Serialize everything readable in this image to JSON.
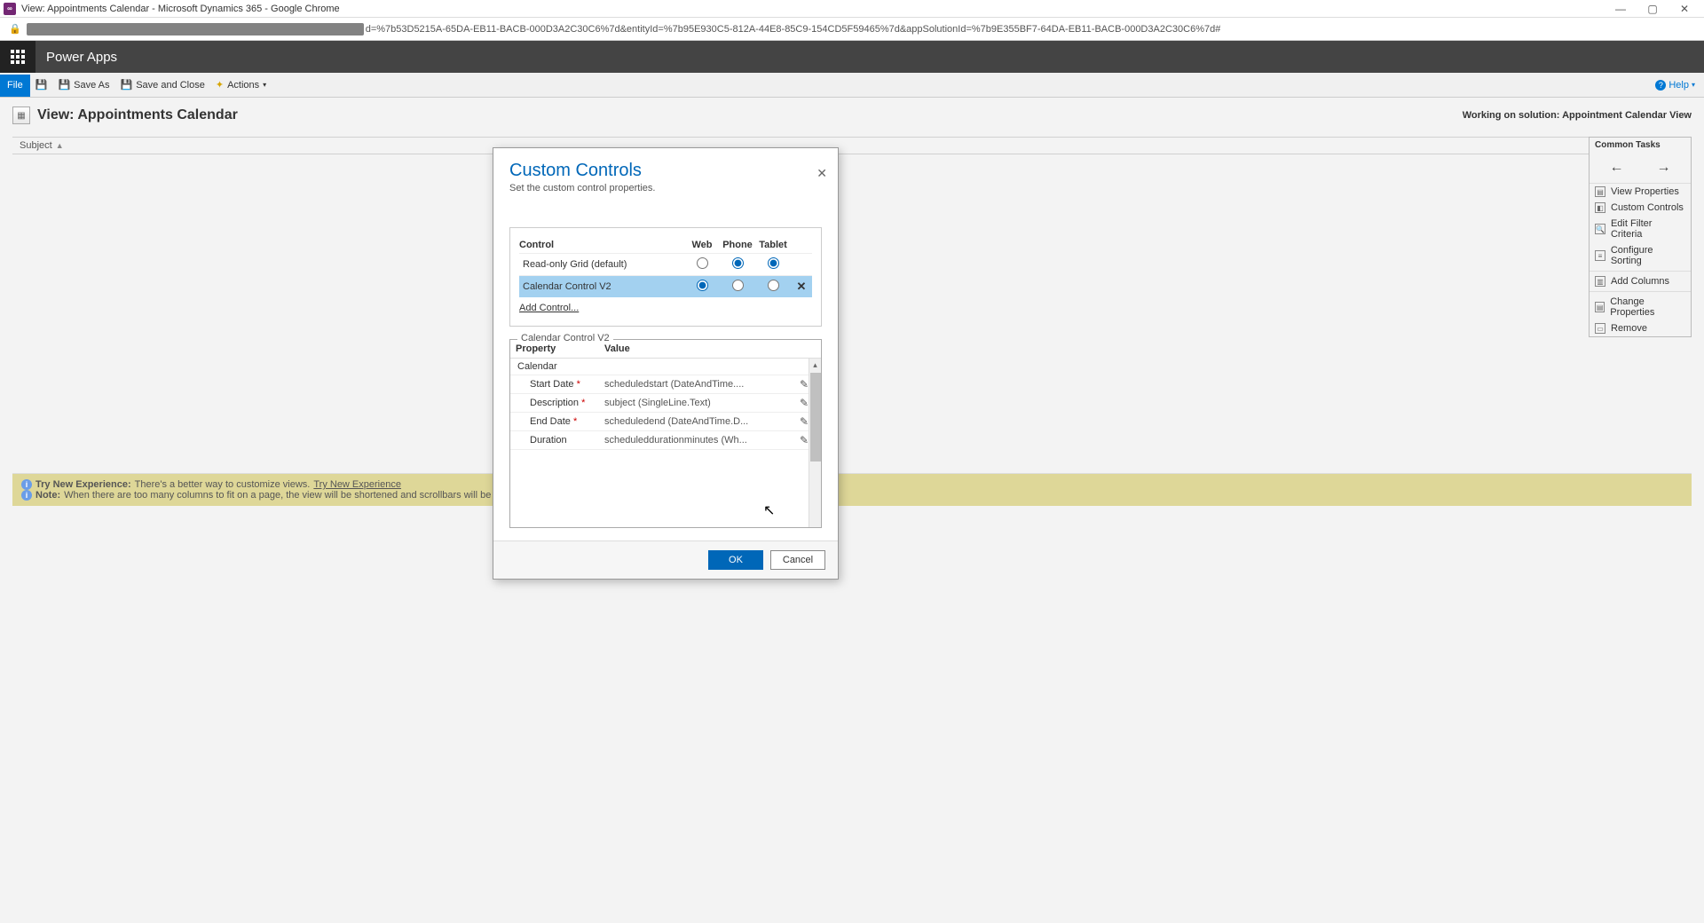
{
  "chrome": {
    "title": "View: Appointments Calendar - Microsoft Dynamics 365 - Google Chrome",
    "url_tail": "d=%7b53D5215A-65DA-EB11-BACB-000D3A2C30C6%7d&entityId=%7b95E930C5-812A-44E8-85C9-154CD5F59465%7d&appSolutionId=%7b9E355BF7-64DA-EB11-BACB-000D3A2C30C6%7d#"
  },
  "pa": {
    "brand": "Power Apps"
  },
  "toolbar": {
    "file": "File",
    "save_as": "Save As",
    "save_close": "Save and Close",
    "actions": "Actions",
    "help": "Help"
  },
  "page": {
    "title": "View: Appointments Calendar",
    "working": "Working on solution: Appointment Calendar View",
    "subject": "Subject"
  },
  "notice": {
    "line1_b": "Try New Experience:",
    "line1": " There's a better way to customize views. ",
    "link": "Try New Experience",
    "line2_b": "Note:",
    "line2": " When there are too many columns to fit on a page, the view will be shortened and scrollbars will be added."
  },
  "tasks": {
    "title": "Common Tasks",
    "view_props": "View Properties",
    "custom_controls": "Custom Controls",
    "edit_filter": "Edit Filter Criteria",
    "configure_sort": "Configure Sorting",
    "add_columns": "Add Columns",
    "change_props": "Change Properties",
    "remove": "Remove"
  },
  "modal": {
    "title": "Custom Controls",
    "subtitle": "Set the custom control properties.",
    "th_control": "Control",
    "th_web": "Web",
    "th_phone": "Phone",
    "th_tablet": "Tablet",
    "row1": "Read-only Grid (default)",
    "row2": "Calendar Control V2",
    "add": "Add Control...",
    "fieldset": "Calendar Control V2",
    "prop_h": "Property",
    "val_h": "Value",
    "group": "Calendar",
    "p_start": "Start Date",
    "v_start": "scheduledstart (DateAndTime....",
    "p_desc": "Description",
    "v_desc": "subject (SingleLine.Text)",
    "p_end": "End Date",
    "v_end": "scheduledend (DateAndTime.D...",
    "p_dur": "Duration",
    "v_dur": "scheduleddurationminutes (Wh...",
    "ok": "OK",
    "cancel": "Cancel"
  }
}
